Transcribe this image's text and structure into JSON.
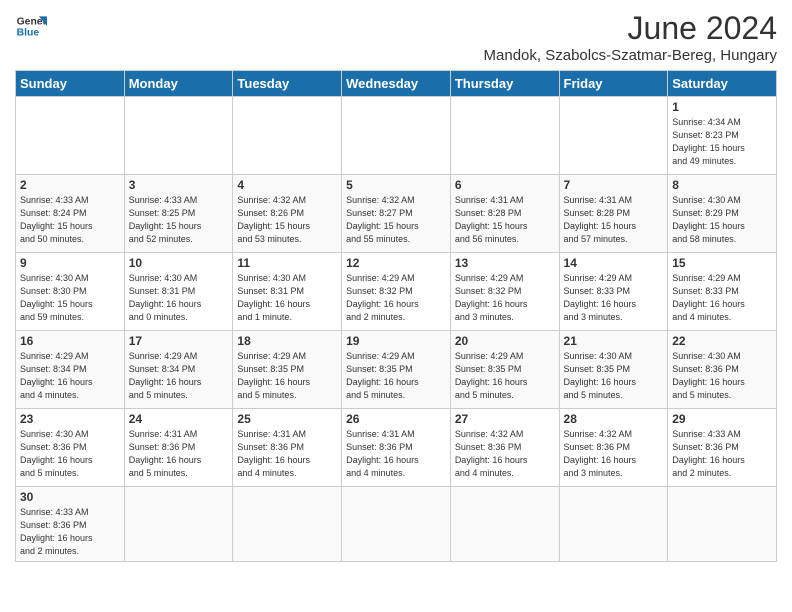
{
  "logo": {
    "text_general": "General",
    "text_blue": "Blue"
  },
  "title": {
    "month": "June 2024",
    "location": "Mandok, Szabolcs-Szatmar-Bereg, Hungary"
  },
  "days_of_week": [
    "Sunday",
    "Monday",
    "Tuesday",
    "Wednesday",
    "Thursday",
    "Friday",
    "Saturday"
  ],
  "weeks": [
    [
      {
        "day": "",
        "info": "",
        "empty": true
      },
      {
        "day": "",
        "info": "",
        "empty": true
      },
      {
        "day": "",
        "info": "",
        "empty": true
      },
      {
        "day": "",
        "info": "",
        "empty": true
      },
      {
        "day": "",
        "info": "",
        "empty": true
      },
      {
        "day": "",
        "info": "",
        "empty": true
      },
      {
        "day": "1",
        "info": "Sunrise: 4:34 AM\nSunset: 8:23 PM\nDaylight: 15 hours\nand 49 minutes.",
        "empty": false
      }
    ],
    [
      {
        "day": "2",
        "info": "Sunrise: 4:33 AM\nSunset: 8:24 PM\nDaylight: 15 hours\nand 50 minutes.",
        "empty": false
      },
      {
        "day": "3",
        "info": "Sunrise: 4:33 AM\nSunset: 8:25 PM\nDaylight: 15 hours\nand 52 minutes.",
        "empty": false
      },
      {
        "day": "4",
        "info": "Sunrise: 4:32 AM\nSunset: 8:26 PM\nDaylight: 15 hours\nand 53 minutes.",
        "empty": false
      },
      {
        "day": "5",
        "info": "Sunrise: 4:32 AM\nSunset: 8:27 PM\nDaylight: 15 hours\nand 55 minutes.",
        "empty": false
      },
      {
        "day": "6",
        "info": "Sunrise: 4:31 AM\nSunset: 8:28 PM\nDaylight: 15 hours\nand 56 minutes.",
        "empty": false
      },
      {
        "day": "7",
        "info": "Sunrise: 4:31 AM\nSunset: 8:28 PM\nDaylight: 15 hours\nand 57 minutes.",
        "empty": false
      },
      {
        "day": "8",
        "info": "Sunrise: 4:30 AM\nSunset: 8:29 PM\nDaylight: 15 hours\nand 58 minutes.",
        "empty": false
      }
    ],
    [
      {
        "day": "9",
        "info": "Sunrise: 4:30 AM\nSunset: 8:30 PM\nDaylight: 15 hours\nand 59 minutes.",
        "empty": false
      },
      {
        "day": "10",
        "info": "Sunrise: 4:30 AM\nSunset: 8:31 PM\nDaylight: 16 hours\nand 0 minutes.",
        "empty": false
      },
      {
        "day": "11",
        "info": "Sunrise: 4:30 AM\nSunset: 8:31 PM\nDaylight: 16 hours\nand 1 minute.",
        "empty": false
      },
      {
        "day": "12",
        "info": "Sunrise: 4:29 AM\nSunset: 8:32 PM\nDaylight: 16 hours\nand 2 minutes.",
        "empty": false
      },
      {
        "day": "13",
        "info": "Sunrise: 4:29 AM\nSunset: 8:32 PM\nDaylight: 16 hours\nand 3 minutes.",
        "empty": false
      },
      {
        "day": "14",
        "info": "Sunrise: 4:29 AM\nSunset: 8:33 PM\nDaylight: 16 hours\nand 3 minutes.",
        "empty": false
      },
      {
        "day": "15",
        "info": "Sunrise: 4:29 AM\nSunset: 8:33 PM\nDaylight: 16 hours\nand 4 minutes.",
        "empty": false
      }
    ],
    [
      {
        "day": "16",
        "info": "Sunrise: 4:29 AM\nSunset: 8:34 PM\nDaylight: 16 hours\nand 4 minutes.",
        "empty": false
      },
      {
        "day": "17",
        "info": "Sunrise: 4:29 AM\nSunset: 8:34 PM\nDaylight: 16 hours\nand 5 minutes.",
        "empty": false
      },
      {
        "day": "18",
        "info": "Sunrise: 4:29 AM\nSunset: 8:35 PM\nDaylight: 16 hours\nand 5 minutes.",
        "empty": false
      },
      {
        "day": "19",
        "info": "Sunrise: 4:29 AM\nSunset: 8:35 PM\nDaylight: 16 hours\nand 5 minutes.",
        "empty": false
      },
      {
        "day": "20",
        "info": "Sunrise: 4:29 AM\nSunset: 8:35 PM\nDaylight: 16 hours\nand 5 minutes.",
        "empty": false
      },
      {
        "day": "21",
        "info": "Sunrise: 4:30 AM\nSunset: 8:35 PM\nDaylight: 16 hours\nand 5 minutes.",
        "empty": false
      },
      {
        "day": "22",
        "info": "Sunrise: 4:30 AM\nSunset: 8:36 PM\nDaylight: 16 hours\nand 5 minutes.",
        "empty": false
      }
    ],
    [
      {
        "day": "23",
        "info": "Sunrise: 4:30 AM\nSunset: 8:36 PM\nDaylight: 16 hours\nand 5 minutes.",
        "empty": false
      },
      {
        "day": "24",
        "info": "Sunrise: 4:31 AM\nSunset: 8:36 PM\nDaylight: 16 hours\nand 5 minutes.",
        "empty": false
      },
      {
        "day": "25",
        "info": "Sunrise: 4:31 AM\nSunset: 8:36 PM\nDaylight: 16 hours\nand 4 minutes.",
        "empty": false
      },
      {
        "day": "26",
        "info": "Sunrise: 4:31 AM\nSunset: 8:36 PM\nDaylight: 16 hours\nand 4 minutes.",
        "empty": false
      },
      {
        "day": "27",
        "info": "Sunrise: 4:32 AM\nSunset: 8:36 PM\nDaylight: 16 hours\nand 4 minutes.",
        "empty": false
      },
      {
        "day": "28",
        "info": "Sunrise: 4:32 AM\nSunset: 8:36 PM\nDaylight: 16 hours\nand 3 minutes.",
        "empty": false
      },
      {
        "day": "29",
        "info": "Sunrise: 4:33 AM\nSunset: 8:36 PM\nDaylight: 16 hours\nand 2 minutes.",
        "empty": false
      }
    ],
    [
      {
        "day": "30",
        "info": "Sunrise: 4:33 AM\nSunset: 8:36 PM\nDaylight: 16 hours\nand 2 minutes.",
        "empty": false
      },
      {
        "day": "",
        "info": "",
        "empty": true
      },
      {
        "day": "",
        "info": "",
        "empty": true
      },
      {
        "day": "",
        "info": "",
        "empty": true
      },
      {
        "day": "",
        "info": "",
        "empty": true
      },
      {
        "day": "",
        "info": "",
        "empty": true
      },
      {
        "day": "",
        "info": "",
        "empty": true
      }
    ]
  ]
}
